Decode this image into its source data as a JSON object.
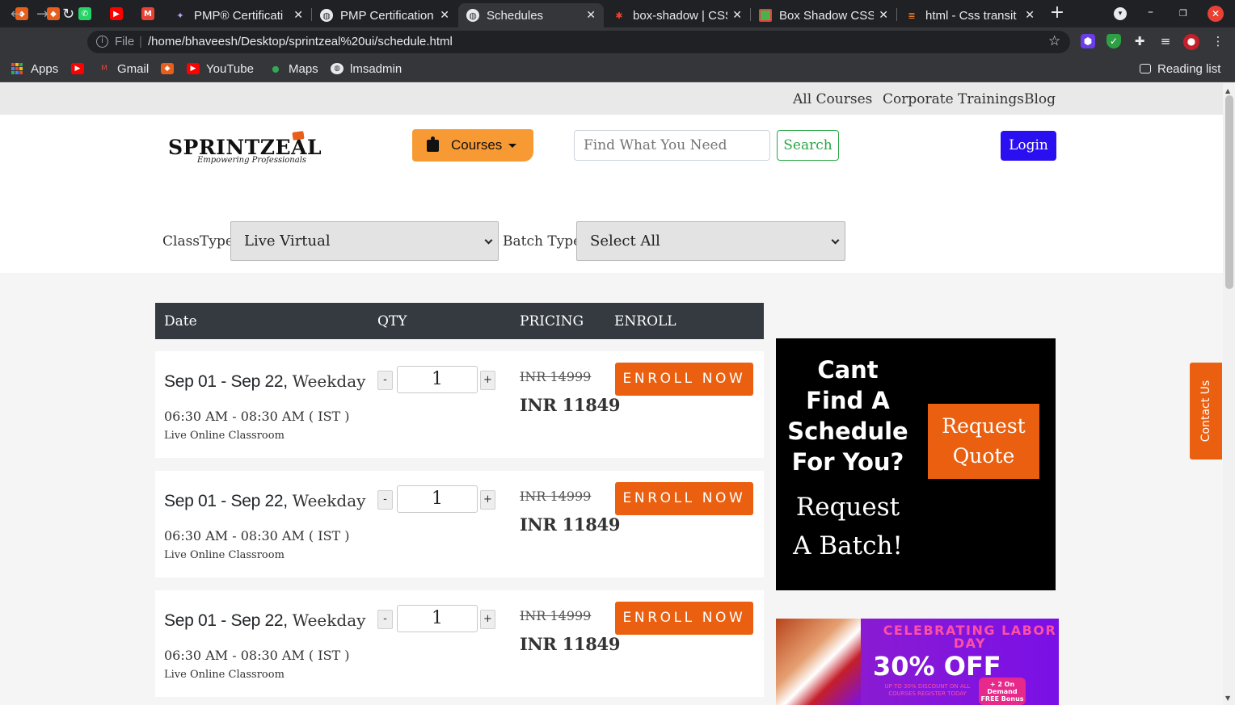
{
  "browser": {
    "pinned_tabs": [
      {
        "name": "sprintzeal-favicon",
        "color": "#e85f1c",
        "glyph": "◆"
      },
      {
        "name": "sprintzeal-favicon",
        "color": "#e85f1c",
        "glyph": "◆"
      },
      {
        "name": "whatsapp-icon",
        "color": "#25d366",
        "glyph": "✆"
      },
      {
        "name": "youtube-icon",
        "color": "#ff0000",
        "glyph": "▶"
      },
      {
        "name": "gmail-icon",
        "color": "#ea4335",
        "glyph": "M"
      }
    ],
    "tabs": [
      {
        "title": "PMP® Certificati",
        "icon": "pmp-favicon",
        "active": false
      },
      {
        "title": "PMP Certification",
        "icon": "globe-icon",
        "active": false
      },
      {
        "title": "Schedules",
        "icon": "globe-icon",
        "active": true
      },
      {
        "title": "box-shadow | CSS",
        "icon": "css-tricks-icon",
        "active": false
      },
      {
        "title": "Box Shadow CSS",
        "icon": "box-shadow-icon",
        "active": false
      },
      {
        "title": "html - Css transit",
        "icon": "stackoverflow-icon",
        "active": false
      }
    ],
    "close_glyph": "✕",
    "new_tab_glyph": "+",
    "url_scheme": "File",
    "url": "/home/bhaveesh/Desktop/sprintzeal%20ui/schedule.html",
    "bookmarks": {
      "apps": "Apps",
      "items": [
        {
          "label": "",
          "icon": "youtube-icon"
        },
        {
          "label": "Gmail",
          "icon": "gmail-icon"
        },
        {
          "label": "",
          "icon": "sprintzeal-icon"
        },
        {
          "label": "YouTube",
          "icon": "youtube-icon"
        },
        {
          "label": "Maps",
          "icon": "maps-icon"
        },
        {
          "label": "lmsadmin",
          "icon": "globe-icon"
        }
      ],
      "reading_list": "Reading list"
    }
  },
  "topnav": {
    "links": [
      "All Courses",
      "Corporate Trainings",
      "Blog"
    ]
  },
  "header": {
    "logo_text": "SPRINTZEAL",
    "logo_tagline": "Empowering Professionals",
    "courses_label": "Courses",
    "search_placeholder": "Find What You Need",
    "search_label": "Search",
    "login_label": "Login"
  },
  "filters": {
    "class_type_label": "ClassType:",
    "class_type_value": "Live Virtual",
    "batch_type_label": "Batch Type:",
    "batch_type_value": "Select All"
  },
  "schedule": {
    "columns": [
      "Date",
      "QTY",
      "PRICING",
      "ENROLL"
    ],
    "rows": [
      {
        "date": "Sep 01 - Sep 22,",
        "weekday": "Weekday",
        "time": "06:30 AM - 08:30 AM ( IST )",
        "mode": "Live Online Classroom",
        "qty": "1",
        "old_price": "INR 14999",
        "price": "INR 11849",
        "enroll": "ENROLL NOW"
      },
      {
        "date": "Sep 01 - Sep 22,",
        "weekday": "Weekday",
        "time": "06:30 AM - 08:30 AM ( IST )",
        "mode": "Live Online Classroom",
        "qty": "1",
        "old_price": "INR 14999",
        "price": "INR 11849",
        "enroll": "ENROLL NOW"
      },
      {
        "date": "Sep 01 - Sep 22,",
        "weekday": "Weekday",
        "time": "06:30 AM - 08:30 AM ( IST )",
        "mode": "Live Online Classroom",
        "qty": "1",
        "old_price": "INR 14999",
        "price": "INR 11849",
        "enroll": "ENROLL NOW"
      }
    ],
    "minus": "-",
    "plus": "+"
  },
  "promo": {
    "question": "Cant Find A Schedule For You?",
    "request_batch": "Request A Batch!",
    "request_quote": "Request Quote"
  },
  "banner": {
    "line1": "CELEBRATING LABOR DAY",
    "line2": "30% OFF",
    "line3": "UP TO 30% DISCOUNT ON ALL COURSES REGISTER TODAY",
    "badge": "+ 2 On Demand FREE Bonus"
  },
  "contact_us": "Contact Us",
  "colors": {
    "accent_orange": "#eb6010",
    "courses_orange": "#f79a34",
    "login_blue": "#2a0ff0",
    "search_green": "#28a745",
    "table_header": "#343a40"
  }
}
